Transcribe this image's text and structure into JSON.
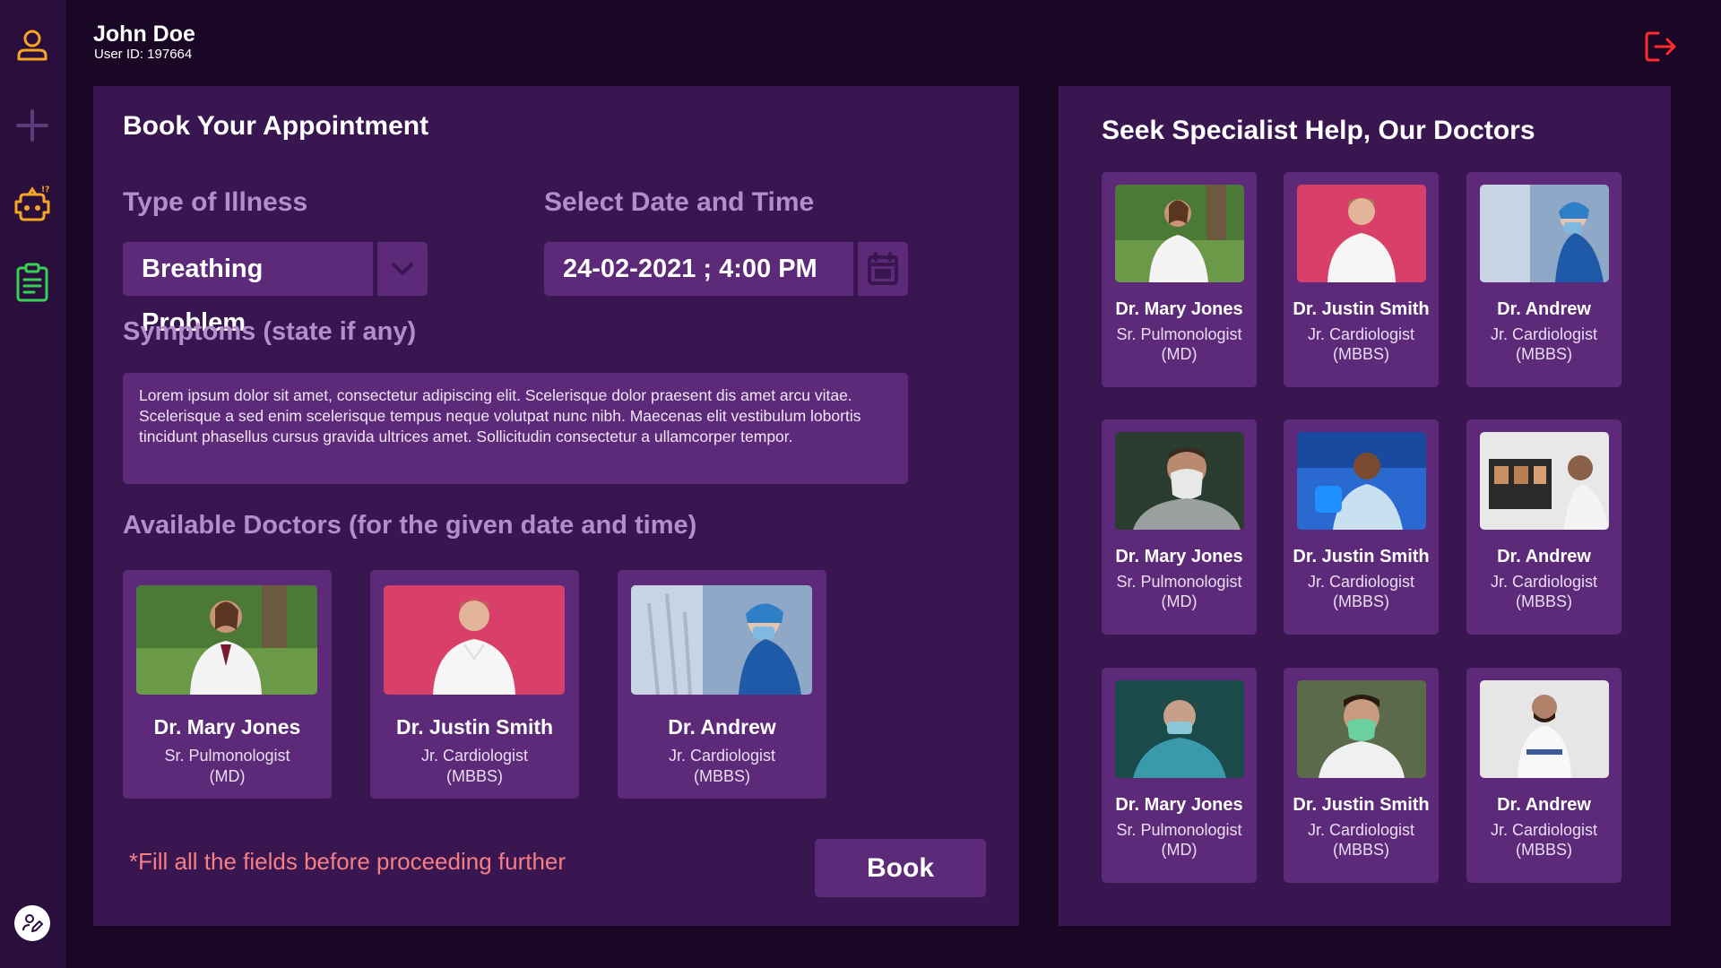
{
  "user": {
    "name": "John Doe",
    "id_text": "User ID: 197664"
  },
  "colors": {
    "background": "#1a0725",
    "sidebar": "#2a0e3c",
    "panel": "#3a1650",
    "card": "#5c2a78",
    "label": "#b48ecb",
    "warning": "#f47f84",
    "user_icon": "#f5a623",
    "plus_icon": "#5d3a78",
    "bot_icon": "#f5a623",
    "clipboard_icon": "#37d158",
    "logout_icon": "#ff2a2a"
  },
  "sidebar": {
    "icons": [
      "user-icon",
      "plus-icon",
      "robot-icon",
      "clipboard-icon",
      "edit-profile-icon"
    ]
  },
  "booking": {
    "title": "Book Your Appointment",
    "illness_label": "Type of Illness",
    "illness_value": "Breathing Problem",
    "datetime_label": "Select Date and Time",
    "datetime_value": "24-02-2021 ; 4:00 PM",
    "symptoms_label": "Symptoms (state if any)",
    "symptoms_text": "Lorem ipsum dolor sit amet, consectetur adipiscing elit. Scelerisque dolor praesent dis amet arcu vitae. Scelerisque a sed enim scelerisque tempus neque volutpat nunc nibh. Maecenas elit vestibulum lobortis tincidunt phasellus cursus gravida ultrices amet. Sollicitudin consectetur a ullamcorper tempor.",
    "available_label": "Available Doctors (for the given date and time)",
    "available_doctors": [
      {
        "name": "Dr. Mary Jones",
        "spec": "Sr. Pulmonologist",
        "degree": "(MD)"
      },
      {
        "name": "Dr. Justin Smith",
        "spec": "Jr. Cardiologist",
        "degree": "(MBBS)"
      },
      {
        "name": "Dr. Andrew",
        "spec": "Jr. Cardiologist",
        "degree": "(MBBS)"
      }
    ],
    "warning": "*Fill all the fields before proceeding further",
    "book_label": "Book"
  },
  "specialists": {
    "title": "Seek Specialist Help, Our Doctors",
    "doctors": [
      {
        "name": "Dr. Mary Jones",
        "spec": "Sr. Pulmonologist",
        "degree": "(MD)"
      },
      {
        "name": "Dr. Justin Smith",
        "spec": "Jr. Cardiologist",
        "degree": "(MBBS)"
      },
      {
        "name": "Dr. Andrew",
        "spec": "Jr. Cardiologist",
        "degree": "(MBBS)"
      },
      {
        "name": "Dr. Mary Jones",
        "spec": "Sr. Pulmonologist",
        "degree": "(MD)"
      },
      {
        "name": "Dr. Justin Smith",
        "spec": "Jr. Cardiologist",
        "degree": "(MBBS)"
      },
      {
        "name": "Dr. Andrew",
        "spec": "Jr. Cardiologist",
        "degree": "(MBBS)"
      },
      {
        "name": "Dr. Mary Jones",
        "spec": "Sr. Pulmonologist",
        "degree": "(MD)"
      },
      {
        "name": "Dr. Justin Smith",
        "spec": "Jr. Cardiologist",
        "degree": "(MBBS)"
      },
      {
        "name": "Dr. Andrew",
        "spec": "Jr. Cardiologist",
        "degree": "(MBBS)"
      }
    ]
  }
}
